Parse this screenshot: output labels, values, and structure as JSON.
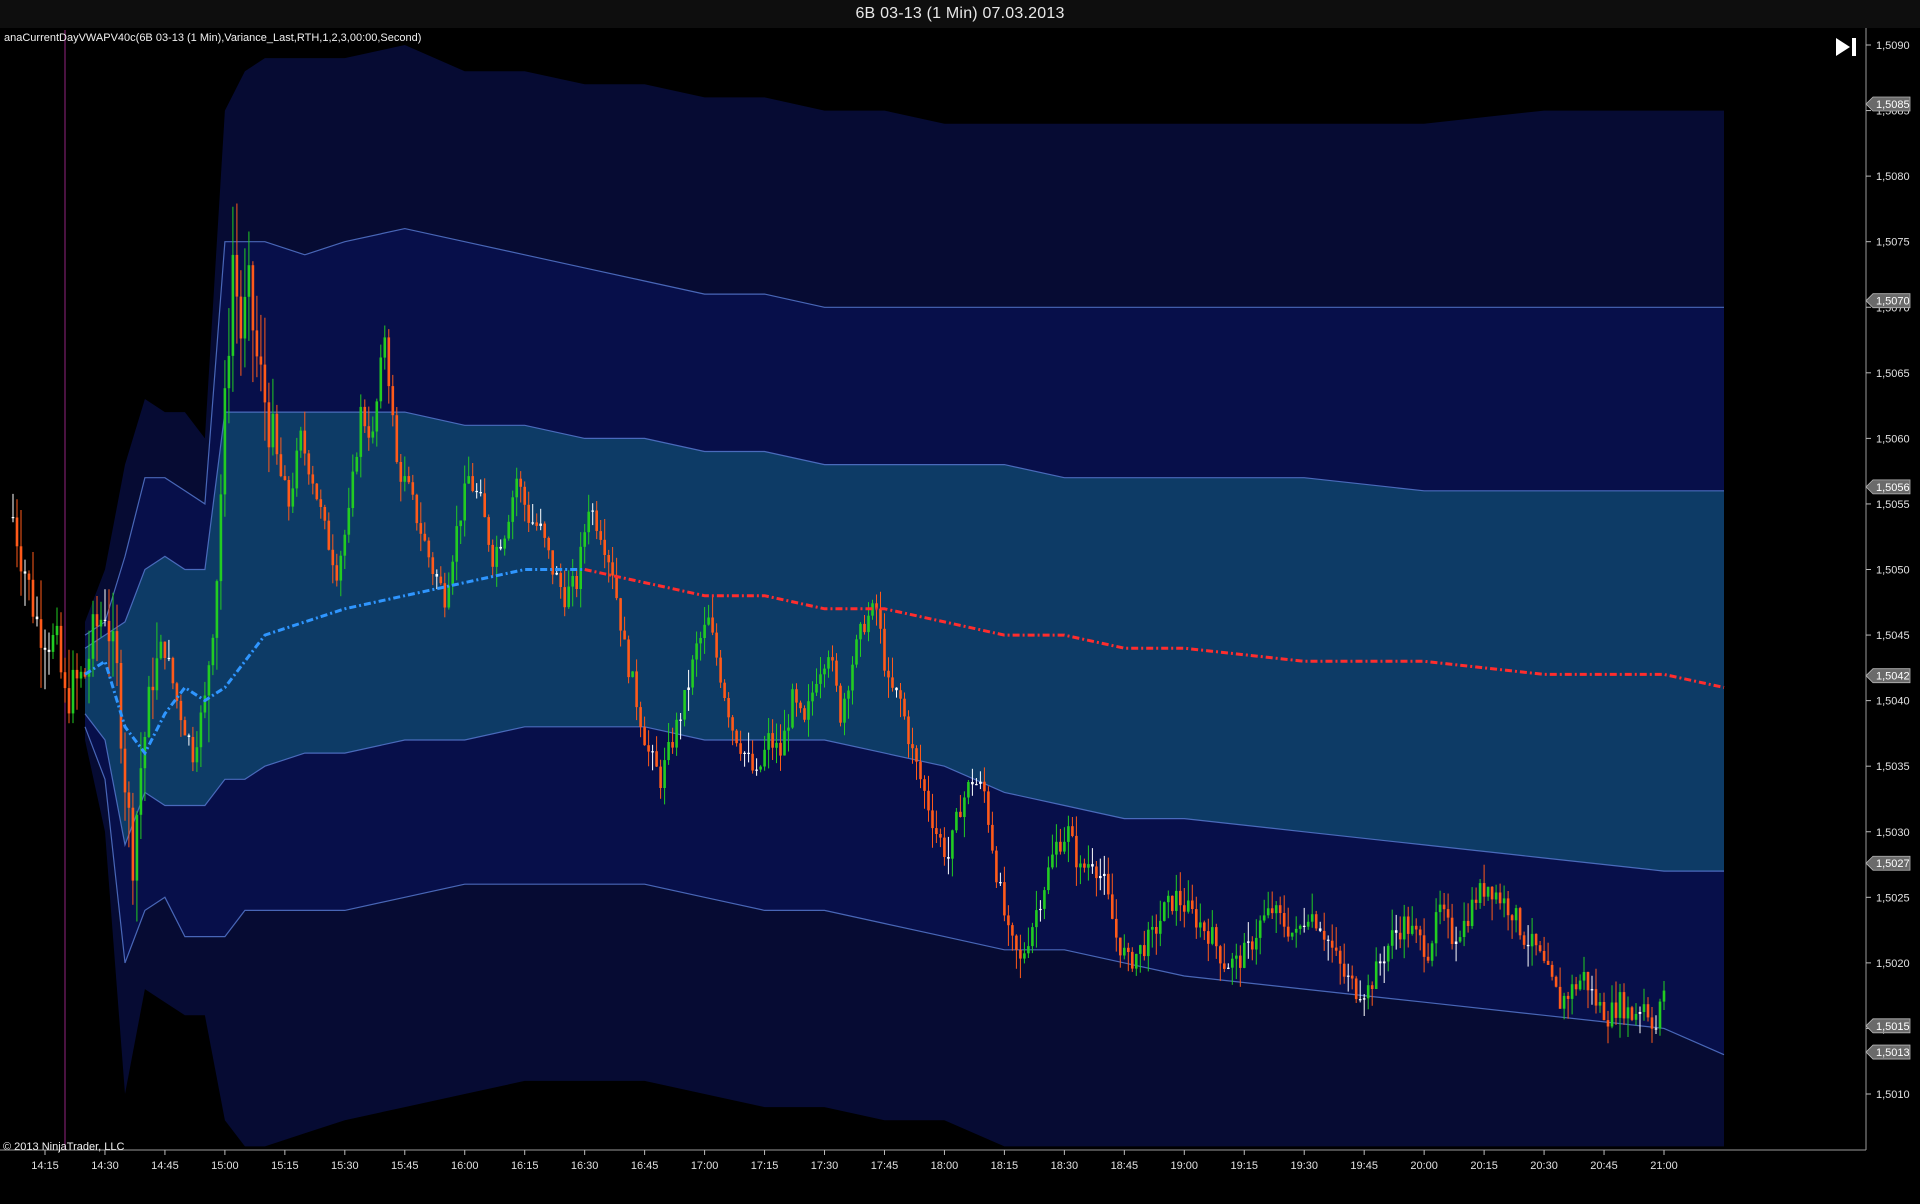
{
  "window": {
    "title": "6B 03-13 (1 Min)  07.03.2013"
  },
  "indicator": {
    "label": "anaCurrentDayVWAPV40c(6B 03-13 (1 Min),Variance_Last,RTH,1,2,3,00:00,Second)"
  },
  "copyright": "© 2013 NinjaTrader, LLC",
  "icons": {
    "scroll_to_end": "skip-to-end-icon"
  },
  "colors": {
    "background": "#000000",
    "band_outer": "#060b33",
    "band_middle": "#070f4a",
    "band_inner": "#0d3b66",
    "band_edge": "#5577cc",
    "vwap_up": "#2f96ff",
    "vwap_down": "#ff2d2d",
    "bar_up": "#22cc22",
    "bar_down": "#ff5a1a"
  },
  "chart_data": {
    "type": "candlestick",
    "instrument": "6B 03-13 (1 Min)",
    "date": "07.03.2013",
    "xlim": [
      "14:07",
      "21:30"
    ],
    "ylim": [
      1.5006,
      1.5092
    ],
    "x_ticks": [
      "14:15",
      "14:30",
      "14:45",
      "15:00",
      "15:15",
      "15:30",
      "15:45",
      "16:00",
      "16:15",
      "16:30",
      "16:45",
      "17:00",
      "17:15",
      "17:30",
      "17:45",
      "18:00",
      "18:15",
      "18:30",
      "18:45",
      "19:00",
      "19:15",
      "19:30",
      "19:45",
      "20:00",
      "20:15",
      "20:30",
      "20:45",
      "21:00"
    ],
    "y_ticks": [
      "1,5010",
      "1,5015",
      "1,5020",
      "1,5025",
      "1,5030",
      "1,5035",
      "1,5040",
      "1,5045",
      "1,5050",
      "1,5055",
      "1,5060",
      "1,5065",
      "1,5070",
      "1,5075",
      "1,5080",
      "1,5085",
      "1,5090"
    ],
    "price_markers": [
      {
        "label": "1,5085",
        "value": 1.50855
      },
      {
        "label": "1,5070",
        "value": 1.50705
      },
      {
        "label": "1,5056",
        "value": 1.50563
      },
      {
        "label": "1,5042",
        "value": 1.50419
      },
      {
        "label": "1,5027",
        "value": 1.50276
      },
      {
        "label": "1,5015",
        "value": 1.50152
      },
      {
        "label": "1,5013",
        "value": 1.50132
      }
    ],
    "time_x": [
      "14:25",
      "14:30",
      "14:35",
      "14:40",
      "14:45",
      "14:50",
      "14:55",
      "15:00",
      "15:05",
      "15:10",
      "15:20",
      "15:30",
      "15:45",
      "16:00",
      "16:15",
      "16:30",
      "16:45",
      "17:00",
      "17:15",
      "17:30",
      "17:45",
      "18:00",
      "18:15",
      "18:30",
      "18:45",
      "19:00",
      "19:30",
      "20:00",
      "20:30",
      "21:00",
      "21:15"
    ],
    "vwap": [
      1.5042,
      1.5043,
      1.5038,
      1.5036,
      1.5039,
      1.5041,
      1.504,
      1.5041,
      1.5043,
      1.5045,
      1.5046,
      1.5047,
      1.5048,
      1.5049,
      1.505,
      1.505,
      1.5049,
      1.5048,
      1.5048,
      1.5047,
      1.5047,
      1.5046,
      1.5045,
      1.5045,
      1.5044,
      1.5044,
      1.5043,
      1.5043,
      1.5042,
      1.5042,
      1.5041
    ],
    "bands": {
      "upper_3": [
        1.5046,
        1.505,
        1.5058,
        1.5063,
        1.5062,
        1.5062,
        1.506,
        1.5085,
        1.5088,
        1.5089,
        1.5089,
        1.5089,
        1.509,
        1.5088,
        1.5088,
        1.5087,
        1.5087,
        1.5086,
        1.5086,
        1.5085,
        1.5085,
        1.5084,
        1.5084,
        1.5084,
        1.5084,
        1.5084,
        1.5084,
        1.5084,
        1.5085,
        1.5085,
        1.5085
      ],
      "upper_2": [
        1.5045,
        1.5046,
        1.5051,
        1.5057,
        1.5057,
        1.5056,
        1.5055,
        1.5075,
        1.5075,
        1.5075,
        1.5074,
        1.5075,
        1.5076,
        1.5075,
        1.5074,
        1.5073,
        1.5072,
        1.5071,
        1.5071,
        1.507,
        1.507,
        1.507,
        1.507,
        1.507,
        1.507,
        1.507,
        1.507,
        1.507,
        1.507,
        1.507,
        1.507
      ],
      "upper_1": [
        1.5044,
        1.5045,
        1.5046,
        1.505,
        1.5051,
        1.505,
        1.505,
        1.5062,
        1.5062,
        1.5062,
        1.5062,
        1.5062,
        1.5062,
        1.5061,
        1.5061,
        1.506,
        1.506,
        1.5059,
        1.5059,
        1.5058,
        1.5058,
        1.5058,
        1.5058,
        1.5057,
        1.5057,
        1.5057,
        1.5057,
        1.5056,
        1.5056,
        1.5056,
        1.5056
      ],
      "lower_1": [
        1.5039,
        1.5037,
        1.5029,
        1.5033,
        1.5032,
        1.5032,
        1.5032,
        1.5034,
        1.5034,
        1.5035,
        1.5036,
        1.5036,
        1.5037,
        1.5037,
        1.5038,
        1.5038,
        1.5038,
        1.5037,
        1.5037,
        1.5037,
        1.5036,
        1.5035,
        1.5033,
        1.5032,
        1.5031,
        1.5031,
        1.503,
        1.5029,
        1.5028,
        1.5027,
        1.5027
      ],
      "lower_2": [
        1.5038,
        1.5034,
        1.502,
        1.5024,
        1.5025,
        1.5022,
        1.5022,
        1.5022,
        1.5024,
        1.5024,
        1.5024,
        1.5024,
        1.5025,
        1.5026,
        1.5026,
        1.5026,
        1.5026,
        1.5025,
        1.5024,
        1.5024,
        1.5023,
        1.5022,
        1.5021,
        1.5021,
        1.502,
        1.5019,
        1.5018,
        1.5017,
        1.5016,
        1.5015,
        1.5013
      ],
      "lower_3": [
        1.5037,
        1.503,
        1.501,
        1.5018,
        1.5017,
        1.5016,
        1.5016,
        1.5008,
        1.5006,
        1.5006,
        1.5007,
        1.5008,
        1.5009,
        1.501,
        1.5011,
        1.5011,
        1.5011,
        1.501,
        1.5009,
        1.5009,
        1.5008,
        1.5008,
        1.5006,
        1.5006,
        1.5006,
        1.5006,
        1.5006,
        1.5006,
        1.5006,
        1.5006,
        1.5006
      ]
    },
    "price_path": [
      [
        "14:07",
        1.5054
      ],
      [
        "14:13",
        1.5046
      ],
      [
        "14:18",
        1.5044
      ],
      [
        "14:20",
        1.504
      ],
      [
        "14:22",
        1.5041
      ],
      [
        "14:25",
        1.5042
      ],
      [
        "14:27",
        1.5045
      ],
      [
        "14:30",
        1.5047
      ],
      [
        "14:33",
        1.5042
      ],
      [
        "14:35",
        1.5034
      ],
      [
        "14:37",
        1.5028
      ],
      [
        "14:39",
        1.5035
      ],
      [
        "14:42",
        1.5042
      ],
      [
        "14:45",
        1.5044
      ],
      [
        "14:48",
        1.504
      ],
      [
        "14:52",
        1.5036
      ],
      [
        "14:55",
        1.504
      ],
      [
        "14:58",
        1.505
      ],
      [
        "15:00",
        1.5062
      ],
      [
        "15:02",
        1.5074
      ],
      [
        "15:04",
        1.5068
      ],
      [
        "15:06",
        1.5071
      ],
      [
        "15:08",
        1.5066
      ],
      [
        "15:10",
        1.5063
      ],
      [
        "15:13",
        1.5058
      ],
      [
        "15:16",
        1.5055
      ],
      [
        "15:19",
        1.506
      ],
      [
        "15:22",
        1.5057
      ],
      [
        "15:25",
        1.5053
      ],
      [
        "15:28",
        1.505
      ],
      [
        "15:31",
        1.5054
      ],
      [
        "15:34",
        1.5062
      ],
      [
        "15:37",
        1.506
      ],
      [
        "15:40",
        1.5068
      ],
      [
        "15:43",
        1.5058
      ],
      [
        "15:46",
        1.5056
      ],
      [
        "15:49",
        1.5053
      ],
      [
        "15:52",
        1.505
      ],
      [
        "15:55",
        1.5048
      ],
      [
        "15:58",
        1.5053
      ],
      [
        "16:01",
        1.5057
      ],
      [
        "16:04",
        1.5055
      ],
      [
        "16:07",
        1.5051
      ],
      [
        "16:10",
        1.5053
      ],
      [
        "16:13",
        1.5057
      ],
      [
        "16:16",
        1.5054
      ],
      [
        "16:19",
        1.5053
      ],
      [
        "16:22",
        1.505
      ],
      [
        "16:25",
        1.5048
      ],
      [
        "16:28",
        1.5049
      ],
      [
        "16:31",
        1.5055
      ],
      [
        "16:34",
        1.5053
      ],
      [
        "16:37",
        1.505
      ],
      [
        "16:40",
        1.5044
      ],
      [
        "16:43",
        1.504
      ],
      [
        "16:46",
        1.5036
      ],
      [
        "16:49",
        1.5034
      ],
      [
        "16:52",
        1.5037
      ],
      [
        "16:55",
        1.504
      ],
      [
        "16:58",
        1.5044
      ],
      [
        "17:01",
        1.5046
      ],
      [
        "17:04",
        1.5042
      ],
      [
        "17:07",
        1.5038
      ],
      [
        "17:10",
        1.5036
      ],
      [
        "17:13",
        1.5034
      ],
      [
        "17:16",
        1.5037
      ],
      [
        "17:19",
        1.5036
      ],
      [
        "17:22",
        1.504
      ],
      [
        "17:25",
        1.5038
      ],
      [
        "17:28",
        1.5042
      ],
      [
        "17:31",
        1.5044
      ],
      [
        "17:34",
        1.5039
      ],
      [
        "17:37",
        1.5043
      ],
      [
        "17:40",
        1.5046
      ],
      [
        "17:43",
        1.5047
      ],
      [
        "17:46",
        1.5041
      ],
      [
        "17:49",
        1.504
      ],
      [
        "17:52",
        1.5036
      ],
      [
        "17:55",
        1.5033
      ],
      [
        "17:58",
        1.503
      ],
      [
        "18:01",
        1.5028
      ],
      [
        "18:04",
        1.5032
      ],
      [
        "18:07",
        1.5034
      ],
      [
        "18:10",
        1.5033
      ],
      [
        "18:13",
        1.5027
      ],
      [
        "18:16",
        1.5022
      ],
      [
        "18:19",
        1.502
      ],
      [
        "18:22",
        1.5023
      ],
      [
        "18:25",
        1.5026
      ],
      [
        "18:28",
        1.5029
      ],
      [
        "18:31",
        1.503
      ],
      [
        "18:34",
        1.5027
      ],
      [
        "18:37",
        1.5028
      ],
      [
        "18:40",
        1.5026
      ],
      [
        "18:43",
        1.5022
      ],
      [
        "18:46",
        1.502
      ],
      [
        "18:49",
        1.5021
      ],
      [
        "18:52",
        1.5022
      ],
      [
        "18:55",
        1.5024
      ],
      [
        "18:58",
        1.5025
      ],
      [
        "19:01",
        1.5024
      ],
      [
        "19:04",
        1.5023
      ],
      [
        "19:07",
        1.5022
      ],
      [
        "19:10",
        1.502
      ],
      [
        "19:13",
        1.502
      ],
      [
        "19:16",
        1.5021
      ],
      [
        "19:19",
        1.5023
      ],
      [
        "19:22",
        1.5024
      ],
      [
        "19:25",
        1.5023
      ],
      [
        "19:28",
        1.5022
      ],
      [
        "19:31",
        1.5024
      ],
      [
        "19:34",
        1.5023
      ],
      [
        "19:37",
        1.5021
      ],
      [
        "19:40",
        1.5019
      ],
      [
        "19:43",
        1.5018
      ],
      [
        "19:46",
        1.5018
      ],
      [
        "19:49",
        1.502
      ],
      [
        "19:52",
        1.5022
      ],
      [
        "19:55",
        1.5023
      ],
      [
        "19:58",
        1.5022
      ],
      [
        "20:01",
        1.5021
      ],
      [
        "20:04",
        1.5024
      ],
      [
        "20:07",
        1.5022
      ],
      [
        "20:10",
        1.5023
      ],
      [
        "20:13",
        1.5025
      ],
      [
        "20:16",
        1.5026
      ],
      [
        "20:19",
        1.5025
      ],
      [
        "20:22",
        1.5024
      ],
      [
        "20:25",
        1.5022
      ],
      [
        "20:28",
        1.5021
      ],
      [
        "20:31",
        1.5019
      ],
      [
        "20:34",
        1.5017
      ],
      [
        "20:37",
        1.5018
      ],
      [
        "20:40",
        1.5019
      ],
      [
        "20:43",
        1.5017
      ],
      [
        "20:46",
        1.5016
      ],
      [
        "20:49",
        1.5017
      ],
      [
        "20:52",
        1.5016
      ],
      [
        "20:55",
        1.5017
      ],
      [
        "20:58",
        1.5015
      ],
      [
        "21:00",
        1.5018
      ]
    ]
  }
}
